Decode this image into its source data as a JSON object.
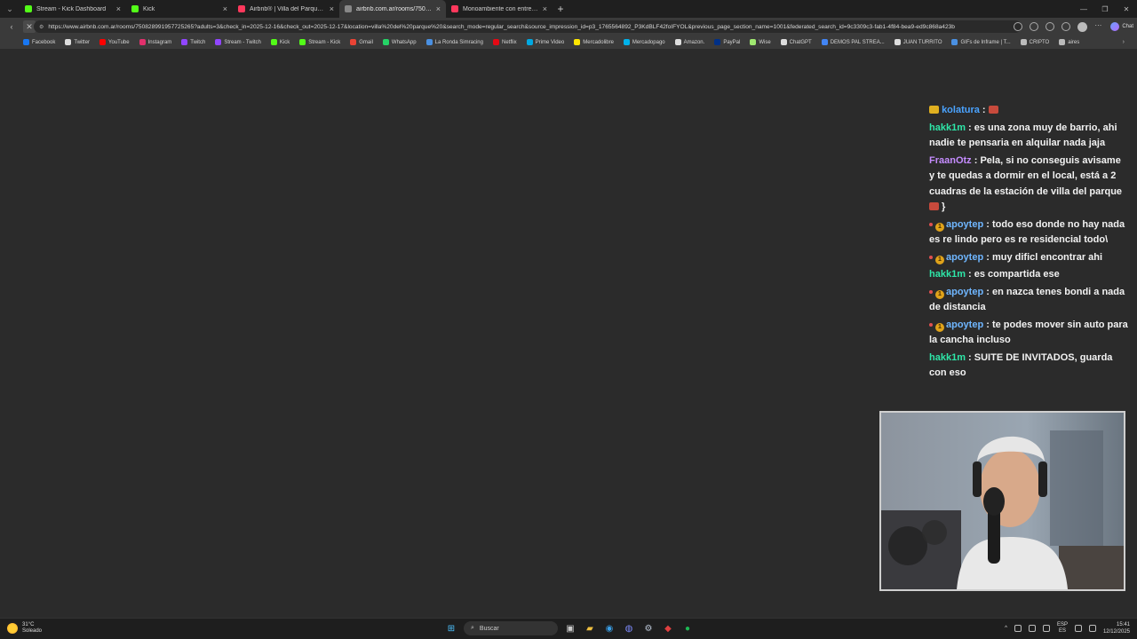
{
  "tabs": [
    {
      "title": "Stream - Kick Dashboard",
      "favicon_color": "#53fc18",
      "active": false
    },
    {
      "title": "Kick",
      "favicon_color": "#53fc18",
      "active": false
    },
    {
      "title": "Airbnb® | Villa del Parque: Alojam",
      "favicon_color": "#ff385c",
      "active": false
    },
    {
      "title": "airbnb.com.ar/rooms/75082891",
      "favicon_color": "#888888",
      "active": true
    },
    {
      "title": "Monoambiente con entrepiso - D",
      "favicon_color": "#ff385c",
      "active": false
    }
  ],
  "address": {
    "url": "https://www.airbnb.com.ar/rooms/750828991957725265?adults=3&check_in=2025-12-16&check_out=2025-12-17&location=villa%20del%20parque%20&search_mode=regular_search&source_impression_id=p3_1765564892_P3KdBLF42foIFYOL&previous_page_section_name=1001&federated_search_id=9c3309c3-fab1-4f84-bea9-ed9c868a423b"
  },
  "toolbar": {
    "chat_label": "Chat"
  },
  "bookmarks": [
    {
      "label": "Facebook",
      "color": "#1877f2"
    },
    {
      "label": "Twitter",
      "color": "#dddddd"
    },
    {
      "label": "YouTube",
      "color": "#ff0000"
    },
    {
      "label": "Instagram",
      "color": "#e1306c"
    },
    {
      "label": "Twitch",
      "color": "#9146ff"
    },
    {
      "label": "Stream - Twitch",
      "color": "#9146ff"
    },
    {
      "label": "Kick",
      "color": "#53fc18"
    },
    {
      "label": "Stream - Kick",
      "color": "#53fc18"
    },
    {
      "label": "Gmail",
      "color": "#ea4335"
    },
    {
      "label": "WhatsApp",
      "color": "#25d366"
    },
    {
      "label": "La Ronda Simracing",
      "color": "#4a90e2"
    },
    {
      "label": "Netflix",
      "color": "#e50914"
    },
    {
      "label": "Prime Video",
      "color": "#00a8e1"
    },
    {
      "label": "Mercadolibre",
      "color": "#ffe600"
    },
    {
      "label": "Mercadopago",
      "color": "#00b1ea"
    },
    {
      "label": "Amazon.",
      "color": "#dddddd"
    },
    {
      "label": "PayPal",
      "color": "#003087"
    },
    {
      "label": "Wise",
      "color": "#9fe870"
    },
    {
      "label": "ChatGPT",
      "color": "#dddddd"
    },
    {
      "label": "DEMOS PAL STREA...",
      "color": "#4285f4"
    },
    {
      "label": "JUAN TURRITO",
      "color": "#dddddd"
    },
    {
      "label": "GIFs de Inframe | T...",
      "color": "#4a90e2"
    },
    {
      "label": "CRIPTO",
      "color": "#bbbbbb"
    },
    {
      "label": "aires",
      "color": "#bbbbbb"
    }
  ],
  "chat": [
    {
      "badges": [
        "emote-y"
      ],
      "user": "kolatura",
      "color": "#4aa3ff",
      "text": "",
      "emote": true
    },
    {
      "badges": [],
      "user": "hakk1m",
      "color": "#2ee6a8",
      "text": "es una zona muy de barrio, ahi nadie te pensaria en alquilar nada jaja"
    },
    {
      "badges": [],
      "user": "FraanOtz",
      "color": "#c58cff",
      "text": "Pela, si no conseguis avisame y te quedas a dormir en el local, está a 2 cuadras de la estación de villa del parque",
      "emote_end": true
    },
    {
      "badges": [
        "dot",
        "gold"
      ],
      "user": "apoytep",
      "color": "#6fb6ff",
      "text": "todo eso donde no hay nada es re lindo pero es re residencial todo\\"
    },
    {
      "badges": [
        "dot",
        "gold"
      ],
      "user": "apoytep",
      "color": "#6fb6ff",
      "text": "muy dificl encontrar ahi"
    },
    {
      "badges": [],
      "user": "hakk1m",
      "color": "#2ee6a8",
      "text": "es compartida ese"
    },
    {
      "badges": [
        "dot",
        "gold"
      ],
      "user": "apoytep",
      "color": "#6fb6ff",
      "text": "en nazca tenes bondi a nada de distancia"
    },
    {
      "badges": [
        "dot",
        "gold"
      ],
      "user": "apoytep",
      "color": "#6fb6ff",
      "text": "te podes mover sin auto para la cancha incluso"
    },
    {
      "badges": [],
      "user": "hakk1m",
      "color": "#2ee6a8",
      "text": "SUITE DE INVITADOS, guarda con eso"
    }
  ],
  "taskbar": {
    "weather_temp": "31°C",
    "weather_desc": "Soleado",
    "search_placeholder": "Buscar",
    "lang_top": "ESP",
    "lang_bottom": "ES",
    "time": "15:41",
    "date": "12/12/2025"
  }
}
